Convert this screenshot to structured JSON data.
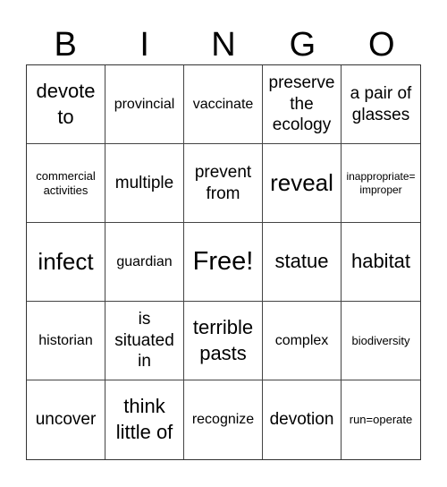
{
  "header": {
    "letters": [
      "B",
      "I",
      "N",
      "G",
      "O"
    ]
  },
  "rows": [
    [
      "devote to",
      "provincial",
      "vaccinate",
      "preserve the ecology",
      "a pair of glasses"
    ],
    [
      "commercial activities",
      "multiple",
      "prevent from",
      "reveal",
      "inappropriate= improper"
    ],
    [
      "infect",
      "guardian",
      "Free!",
      "statue",
      "habitat"
    ],
    [
      "historian",
      "is situated in",
      "terrible pasts",
      "complex",
      "biodiversity"
    ],
    [
      "uncover",
      "think little of",
      "recognize",
      "devotion",
      "run=operate"
    ]
  ]
}
